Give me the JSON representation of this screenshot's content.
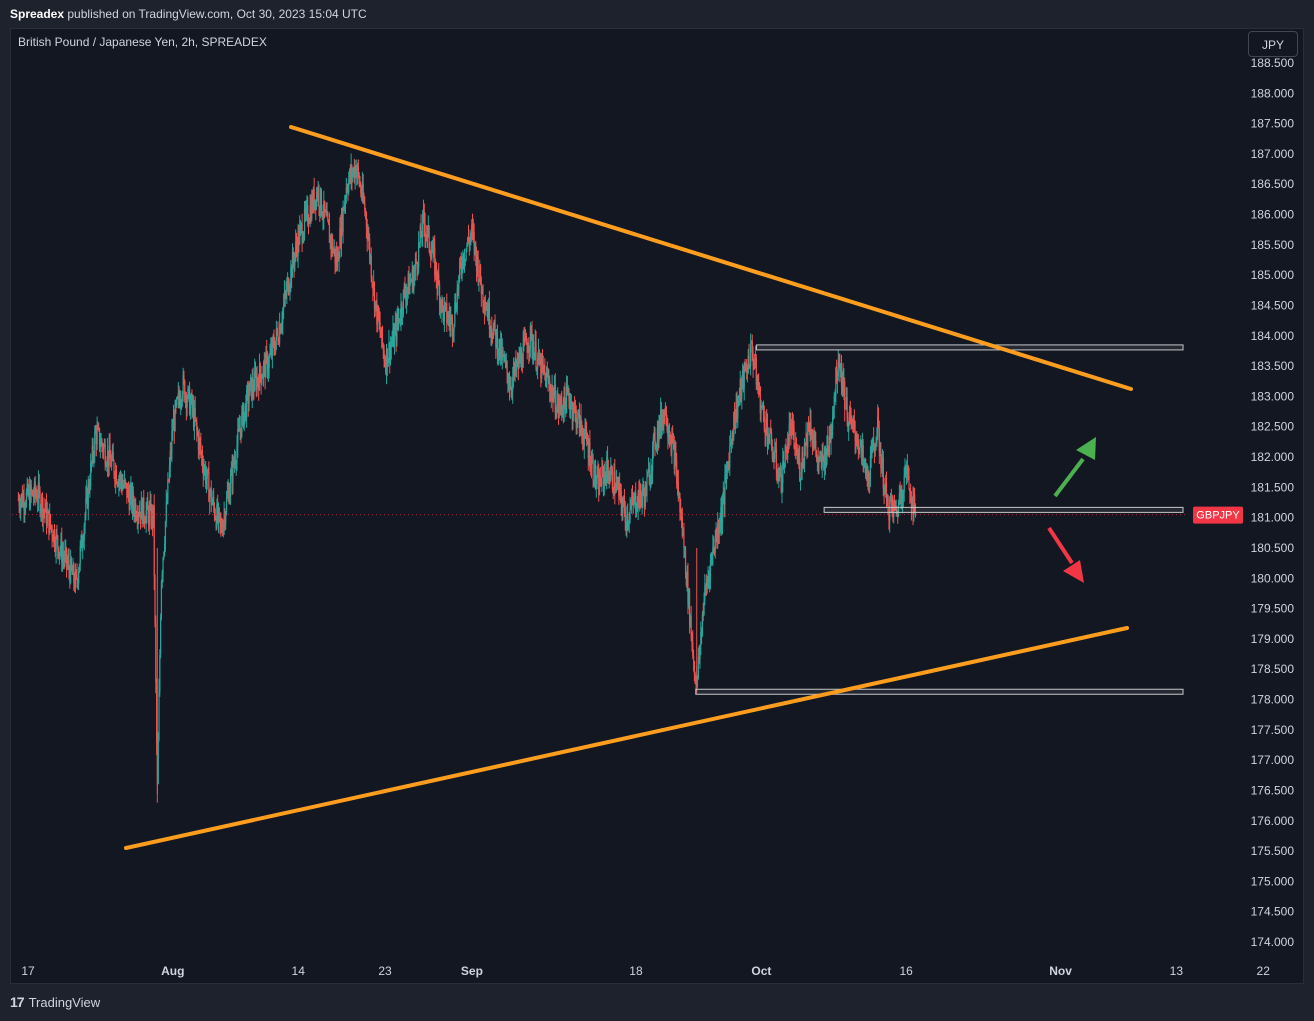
{
  "header": {
    "publisher": "Spreadex",
    "published_text": "published on TradingView.com, Oct 30, 2023 15:04 UTC"
  },
  "symbol": {
    "description": "British Pound / Japanese Yen, 2h, SPREADEX",
    "ticker": "GBPJPY",
    "currency": "JPY",
    "last_price": 181.0
  },
  "footer": {
    "brand": "TradingView"
  },
  "colors": {
    "background": "#131722",
    "up_candle": "#26a69a",
    "down_candle": "#ef5350",
    "trendline": "#ff9d1f",
    "price_tag": "#f23645",
    "arrow_up": "#4caf50",
    "arrow_down": "#f23645"
  },
  "chart_data": {
    "type": "candlestick",
    "title": "British Pound / Japanese Yen, 2h, SPREADEX",
    "ylim": [
      173.7,
      188.6
    ],
    "y_ticks": [
      "188.500",
      "188.000",
      "187.500",
      "187.000",
      "186.500",
      "186.000",
      "185.500",
      "185.000",
      "184.500",
      "184.000",
      "183.500",
      "183.000",
      "182.500",
      "182.000",
      "181.500",
      "181.000",
      "180.500",
      "180.000",
      "179.500",
      "179.000",
      "178.500",
      "178.000",
      "177.500",
      "177.000",
      "176.500",
      "176.000",
      "175.500",
      "175.000",
      "174.500",
      "174.000"
    ],
    "x_ticks": [
      {
        "label": "17",
        "day": 0
      },
      {
        "label": "Aug",
        "day": 15
      },
      {
        "label": "14",
        "day": 28
      },
      {
        "label": "23",
        "day": 37
      },
      {
        "label": "Sep",
        "day": 46
      },
      {
        "label": "18",
        "day": 63
      },
      {
        "label": "Oct",
        "day": 76
      },
      {
        "label": "16",
        "day": 91
      },
      {
        "label": "Nov",
        "day": 107
      },
      {
        "label": "13",
        "day": 119
      },
      {
        "label": "22",
        "day": 128
      }
    ],
    "price_path": [
      [
        -1,
        181.3
      ],
      [
        1,
        181.4
      ],
      [
        3,
        180.6
      ],
      [
        5,
        179.9
      ],
      [
        7,
        182.4
      ],
      [
        9,
        181.8
      ],
      [
        11,
        181.2
      ],
      [
        13,
        181.0
      ],
      [
        13.4,
        176.4
      ],
      [
        13.8,
        180.0
      ],
      [
        15,
        182.5
      ],
      [
        16,
        183.2
      ],
      [
        17,
        182.8
      ],
      [
        18,
        182.0
      ],
      [
        19,
        181.3
      ],
      [
        20,
        180.8
      ],
      [
        21,
        181.6
      ],
      [
        22,
        182.5
      ],
      [
        23,
        183.1
      ],
      [
        25,
        183.6
      ],
      [
        26,
        184.1
      ],
      [
        27,
        184.9
      ],
      [
        28,
        185.6
      ],
      [
        29,
        186.0
      ],
      [
        30,
        186.4
      ],
      [
        31,
        185.8
      ],
      [
        32,
        185.2
      ],
      [
        33,
        186.5
      ],
      [
        34,
        186.8
      ],
      [
        35,
        186.0
      ],
      [
        36,
        184.5
      ],
      [
        37,
        183.6
      ],
      [
        38,
        184.0
      ],
      [
        39,
        184.7
      ],
      [
        40,
        185.0
      ],
      [
        41,
        185.9
      ],
      [
        42,
        185.3
      ],
      [
        43,
        184.4
      ],
      [
        44,
        184.2
      ],
      [
        45,
        185.3
      ],
      [
        46,
        185.7
      ],
      [
        47,
        184.8
      ],
      [
        48,
        184.2
      ],
      [
        49,
        183.7
      ],
      [
        50,
        183.2
      ],
      [
        51,
        183.6
      ],
      [
        52,
        184.0
      ],
      [
        53,
        183.5
      ],
      [
        54,
        183.2
      ],
      [
        55,
        182.8
      ],
      [
        56,
        183.0
      ],
      [
        57,
        182.6
      ],
      [
        58,
        182.2
      ],
      [
        59,
        181.5
      ],
      [
        60,
        181.8
      ],
      [
        61,
        181.5
      ],
      [
        62,
        181.0
      ],
      [
        63,
        181.3
      ],
      [
        64,
        181.4
      ],
      [
        65,
        182.3
      ],
      [
        66,
        182.8
      ],
      [
        67,
        182.0
      ],
      [
        68,
        180.5
      ],
      [
        69,
        178.6
      ],
      [
        69.3,
        178.2
      ],
      [
        70,
        179.6
      ],
      [
        71,
        180.5
      ],
      [
        72,
        181.2
      ],
      [
        73,
        182.5
      ],
      [
        74,
        183.2
      ],
      [
        75,
        183.8
      ],
      [
        76,
        182.8
      ],
      [
        77,
        182.2
      ],
      [
        78,
        181.6
      ],
      [
        79,
        182.5
      ],
      [
        80,
        181.8
      ],
      [
        81,
        182.6
      ],
      [
        82,
        181.8
      ],
      [
        83,
        182.2
      ],
      [
        84,
        183.7
      ],
      [
        85,
        182.6
      ],
      [
        86,
        182.3
      ],
      [
        87,
        181.6
      ],
      [
        88,
        182.5
      ],
      [
        89,
        181.2
      ],
      [
        90,
        181.1
      ],
      [
        91,
        181.8
      ],
      [
        92,
        181.0
      ]
    ],
    "annotations": {
      "upper_trendline": [
        [
          5,
          187.45
        ],
        [
          91,
          183.1
        ]
      ],
      "lower_trendline": [
        [
          -8,
          175.5
        ],
        [
          90,
          179.15
        ]
      ],
      "resistance_zone": [
        [
          75.5,
          183.8
        ],
        [
          100,
          183.75
        ]
      ],
      "current_zone": [
        [
          82.5,
          181.12
        ],
        [
          100,
          181.08
        ]
      ],
      "low_zone": [
        [
          69.2,
          178.12
        ],
        [
          100,
          178.05
        ]
      ],
      "arrow_up": "up",
      "arrow_down": "down"
    }
  }
}
